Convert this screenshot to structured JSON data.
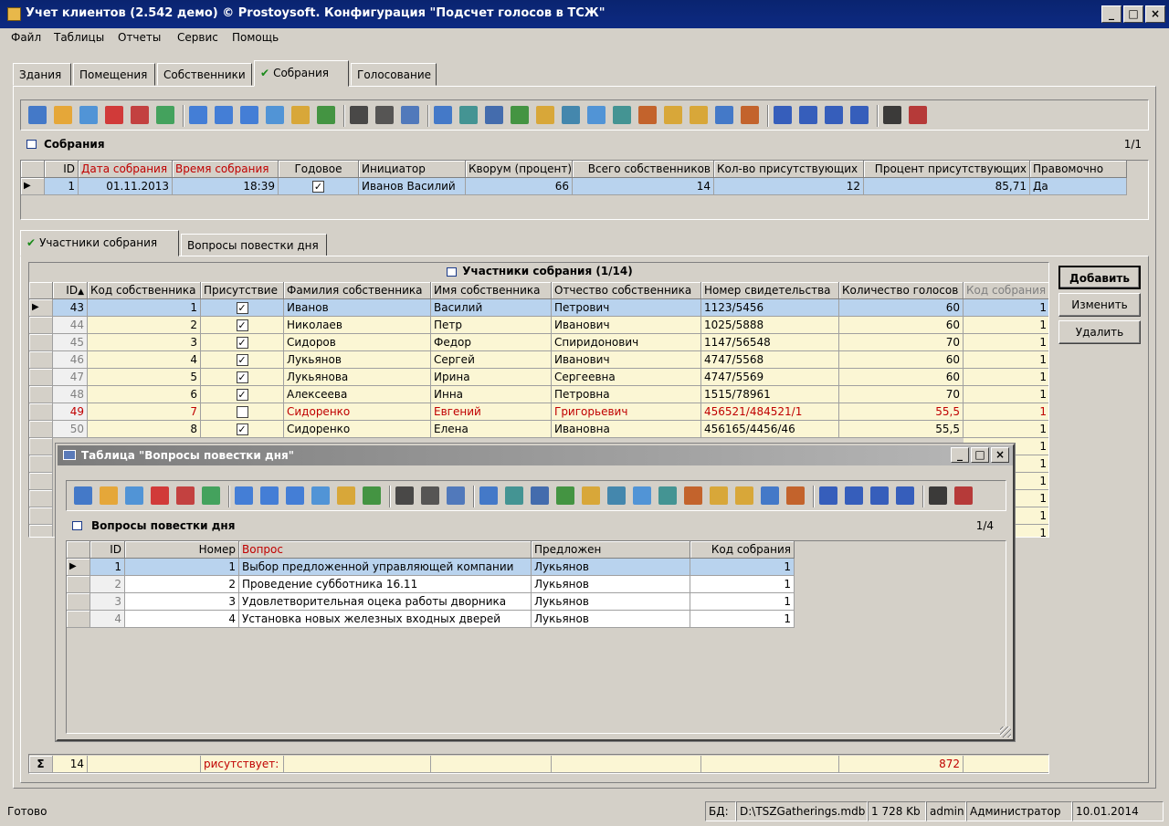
{
  "window": {
    "title": "Учет клиентов (2.542 демо) © Prostoysoft. Конфигурация \"Подсчет голосов в ТСЖ\"",
    "min_btn": "_",
    "max_btn": "□",
    "close_btn": "×"
  },
  "menu": [
    "Файл",
    "Таблицы",
    "Отчеты",
    "Сервис",
    "Помощь"
  ],
  "tabs": [
    "Здания",
    "Помещения",
    "Собственники",
    "Собрания",
    "Голосование"
  ],
  "active_tab": "Собрания",
  "check_mark": "✔",
  "meetings": {
    "title": "Собрания",
    "counter": "1/1",
    "columns": [
      "ID",
      "Дата собрания",
      "Время собрания",
      "Годовое",
      "Инициатор",
      "Кворум (процент)",
      "Всего собственников",
      "Кол-во присутствующих",
      "Процент присутствующих",
      "Правомочно"
    ],
    "row": {
      "id": "1",
      "date": "01.11.2013",
      "time": "18:39",
      "annual": "✓",
      "initiator": "Иванов Василий",
      "quorum": "66",
      "total": "14",
      "present": "12",
      "percent": "85,71",
      "valid": "Да"
    }
  },
  "subtabs": [
    "Участники собрания",
    "Вопросы повестки дня"
  ],
  "participants": {
    "title": "Участники собрания (1/14)",
    "columns": [
      "ID",
      "Код собственника",
      "Присутствие",
      "Фамилия собственника",
      "Имя собственника",
      "Отчество собственника",
      "Номер свидетельства",
      "Количество голосов",
      "Код собрания"
    ],
    "rows": [
      {
        "id": "43",
        "code": "1",
        "present": "✓",
        "last": "Иванов",
        "first": "Василий",
        "middle": "Петрович",
        "cert": "1123/5456",
        "votes": "60",
        "meeting": "1",
        "red": false
      },
      {
        "id": "44",
        "code": "2",
        "present": "✓",
        "last": "Николаев",
        "first": "Петр",
        "middle": "Иванович",
        "cert": "1025/5888",
        "votes": "60",
        "meeting": "1",
        "red": false
      },
      {
        "id": "45",
        "code": "3",
        "present": "✓",
        "last": "Сидоров",
        "first": "Федор",
        "middle": "Спиридонович",
        "cert": "1147/56548",
        "votes": "70",
        "meeting": "1",
        "red": false
      },
      {
        "id": "46",
        "code": "4",
        "present": "✓",
        "last": "Лукьянов",
        "first": "Сергей",
        "middle": "Иванович",
        "cert": "4747/5568",
        "votes": "60",
        "meeting": "1",
        "red": false
      },
      {
        "id": "47",
        "code": "5",
        "present": "✓",
        "last": "Лукьянова",
        "first": "Ирина",
        "middle": "Сергеевна",
        "cert": "4747/5569",
        "votes": "60",
        "meeting": "1",
        "red": false
      },
      {
        "id": "48",
        "code": "6",
        "present": "✓",
        "last": "Алексеева",
        "first": "Инна",
        "middle": "Петровна",
        "cert": "1515/78961",
        "votes": "70",
        "meeting": "1",
        "red": false
      },
      {
        "id": "49",
        "code": "7",
        "present": "",
        "last": "Сидоренко",
        "first": "Евгений",
        "middle": "Григорьевич",
        "cert": "456521/484521/1",
        "votes": "55,5",
        "meeting": "1",
        "red": true
      },
      {
        "id": "50",
        "code": "8",
        "present": "✓",
        "last": "Сидоренко",
        "first": "Елена",
        "middle": "Ивановна",
        "cert": "456165/4456/46",
        "votes": "55,5",
        "meeting": "1",
        "red": false
      }
    ],
    "hidden_meeting_codes": [
      "1",
      "1",
      "1",
      "1",
      "1",
      "1"
    ]
  },
  "buttons": {
    "add": "Добавить",
    "edit": "Изменить",
    "delete": "Удалить"
  },
  "totals": {
    "sigma": "Σ",
    "count": "14",
    "present": "рисутствует: ",
    "votes": "872"
  },
  "agenda_window": {
    "title": "Таблица \"Вопросы повестки дня\"",
    "section_title": "Вопросы повестки дня",
    "counter": "1/4",
    "columns": [
      "ID",
      "Номер",
      "Вопрос",
      "Предложен",
      "Код собрания"
    ],
    "rows": [
      {
        "id": "1",
        "num": "1",
        "question": "Выбор предложенной управляющей компании",
        "by": "Лукьянов",
        "meeting": "1"
      },
      {
        "id": "2",
        "num": "2",
        "question": "Проведение субботника 16.11",
        "by": "Лукьянов",
        "meeting": "1"
      },
      {
        "id": "3",
        "num": "3",
        "question": "Удовлетворительная оцека работы дворника",
        "by": "Лукьянов",
        "meeting": "1"
      },
      {
        "id": "4",
        "num": "4",
        "question": "Установка новых железных входных дверей",
        "by": "Лукьянов",
        "meeting": "1"
      }
    ]
  },
  "status": {
    "ready": "Готово",
    "db_label": "БД:",
    "db_path": "D:\\TSZGatherings.mdb",
    "db_size": "1 728 Kb",
    "user": "admin",
    "role": "Администратор",
    "date": "10.01.2014"
  },
  "colors": {
    "selected_row": "#b9d3ee",
    "odd_row": "#fbf6d4",
    "highlight_red": "#c00000",
    "title_bar": "#0a2470"
  },
  "toolbar_icons": [
    "refresh-icon",
    "edit-icon",
    "copy-icon",
    "delete-icon",
    "cancel-icon",
    "sync-icon",
    "filter-icon",
    "filter-remove-icon",
    "filter-edit-icon",
    "sort-icon",
    "group-icon",
    "sql-icon",
    "find-icon",
    "print-icon",
    "preview-icon",
    "export-icon",
    "import-icon",
    "word-icon",
    "excel-icon",
    "csv-icon",
    "xml-icon",
    "html-icon",
    "text-icon",
    "chart-icon",
    "note-icon",
    "report-icon",
    "grid-icon",
    "columns-icon",
    "first-icon",
    "prev-icon",
    "next-icon",
    "last-icon",
    "view-icon",
    "calc-icon"
  ]
}
